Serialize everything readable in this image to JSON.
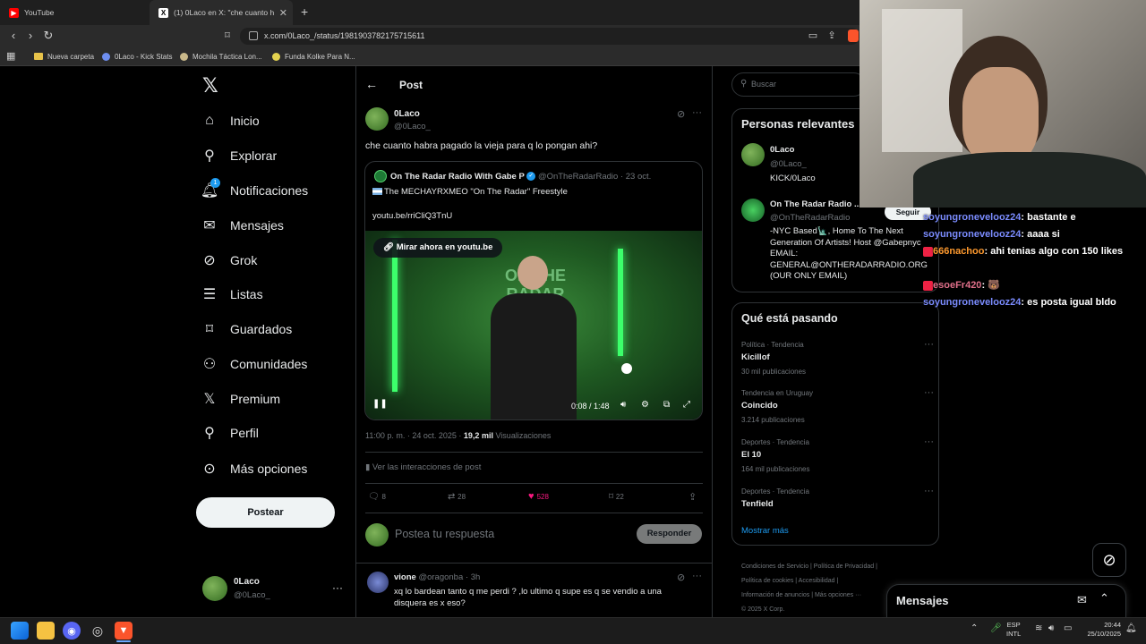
{
  "browser": {
    "tabs": [
      {
        "title": "YouTube"
      },
      {
        "title": "(1) 0Laco en X: \"che cuanto h"
      }
    ],
    "url": "x.com/0Laco_/status/1981903782175715611",
    "bookmarks": [
      "Nueva carpeta",
      "0Laco - Kick Stats",
      "Mochila Táctica Lon...",
      "Funda Kolke Para N..."
    ]
  },
  "sidebar": {
    "items": [
      {
        "label": "Inicio",
        "icon": "home-icon"
      },
      {
        "label": "Explorar",
        "icon": "search-icon"
      },
      {
        "label": "Notificaciones",
        "icon": "bell-icon",
        "badge": "1"
      },
      {
        "label": "Mensajes",
        "icon": "mail-icon"
      },
      {
        "label": "Grok",
        "icon": "grok-icon"
      },
      {
        "label": "Listas",
        "icon": "list-icon"
      },
      {
        "label": "Guardados",
        "icon": "bookmark-icon"
      },
      {
        "label": "Comunidades",
        "icon": "people-icon"
      },
      {
        "label": "Premium",
        "icon": "x-logo-icon"
      },
      {
        "label": "Perfil",
        "icon": "person-icon"
      },
      {
        "label": "Más opciones",
        "icon": "more-circle-icon"
      }
    ],
    "post_button": "Postear",
    "account": {
      "name": "0Laco",
      "handle": "@0Laco_"
    }
  },
  "header": {
    "title": "Post"
  },
  "post": {
    "author": "0Laco",
    "handle": "@0Laco_",
    "text": "che cuanto habra pagado la vieja para q lo pongan ahi?",
    "quote": {
      "author": "On The Radar Radio With Gabe P",
      "handle": "@OnTheRadarRadio",
      "date": "· 23 oct.",
      "line1": "The MECHAYRXMEO \"On The Radar\" Freestyle",
      "link": "youtu.be/rriCliQ3TnU",
      "watch_label": "Mirar ahora en youtu.be",
      "video_time": "0:08 / 1:48"
    },
    "timestamp": "11:00 p. m. · 24 oct. 2025 ·",
    "views": "19,2 mil",
    "views_label": "Visualizaciones",
    "interactions": "Ver las interacciones de post",
    "stats": {
      "replies": "8",
      "reposts": "28",
      "likes": "528",
      "bookmarks": "22"
    },
    "reply_placeholder": "Postea tu respuesta",
    "reply_button": "Responder"
  },
  "reply": {
    "author": "vione",
    "handle": "@oragonba",
    "time": "· 3h",
    "text": "xq lo bardean tanto q me perdi ? ,lo ultimo q supe es q se vendio a una disquera es x eso?"
  },
  "right": {
    "search_placeholder": "Buscar",
    "relevant_title": "Personas relevantes",
    "relevant": [
      {
        "name": "0Laco",
        "handle": "@0Laco_",
        "bio": "KICK/0Laco"
      },
      {
        "name": "On The Radar Radio ...",
        "handle": "@OnTheRadarRadio",
        "follow": "Seguir",
        "bio": "-NYC Based🗽, Home To The Next Generation Of Artists! Host @Gabepnyc EMAIL: GENERAL@ONTHERADARRADIO.ORG (OUR ONLY EMAIL)"
      }
    ],
    "trends_title": "Qué está pasando",
    "trends": [
      {
        "meta": "Política · Tendencia",
        "name": "Kicillof",
        "count": "30 mil publicaciones"
      },
      {
        "meta": "Tendencia en Uruguay",
        "name": "Coincido",
        "count": "3.214 publicaciones"
      },
      {
        "meta": "Deportes · Tendencia",
        "name": "El 10",
        "count": "164 mil publicaciones"
      },
      {
        "meta": "Deportes · Tendencia",
        "name": "Tenfield",
        "count": ""
      }
    ],
    "show_more": "Mostrar más",
    "footer1": "Condiciones de Servicio  |  Política de Privacidad  |",
    "footer2": "Política de cookies  |  Accesibilidad  |",
    "footer3": "Información de anuncios  |  Más opciones ···",
    "footer4": "© 2025 X Corp.",
    "messages_label": "Mensajes"
  },
  "chat": [
    {
      "user": "soyungronevelooz24",
      "msg": "bastante e"
    },
    {
      "user": "soyungronevelooz24",
      "msg": "aaaa si"
    },
    {
      "user": "666nachoo",
      "msg": "ahi tenias algo con 150 likes",
      "color": "#ff9a2e"
    },
    {
      "user": "esoeFr420",
      "msg": "🐻",
      "color": "#e0708a"
    },
    {
      "user": "soyungronevelooz24",
      "msg": "es posta igual bldo"
    }
  ],
  "taskbar": {
    "lang1": "ESP",
    "lang2": "INTL",
    "time": "20:44",
    "date": "25/10/2025"
  },
  "colors": {
    "accent": "#1d9bf0",
    "like": "#f91880",
    "bg": "#000000",
    "border": "#2f3336"
  }
}
